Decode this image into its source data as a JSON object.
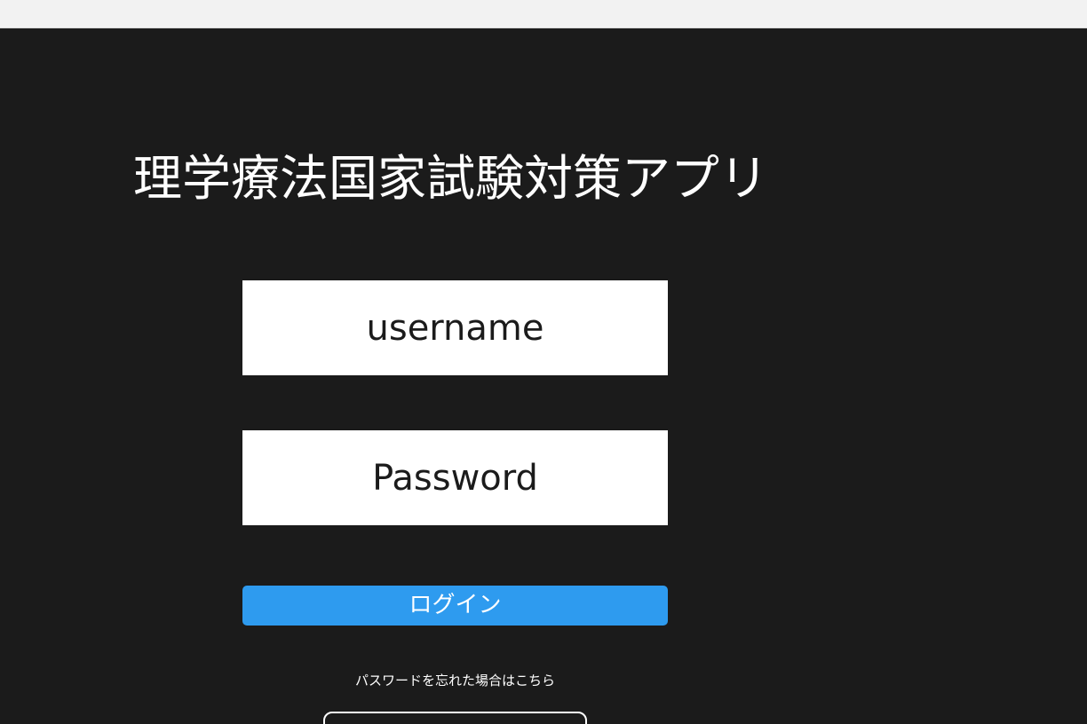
{
  "app": {
    "title": "理学療法国家試験対策アプリ"
  },
  "login_form": {
    "username_placeholder": "username",
    "password_placeholder": "Password",
    "login_label": "ログイン",
    "forgot_password_label": "パスワードを忘れた場合はこちら"
  },
  "colors": {
    "background": "#1b1b1b",
    "top_bar": "#f2f2f2",
    "field_background": "#ffffff",
    "primary_button": "#2e9bef",
    "text_light": "#ffffff",
    "text_dark": "#1b1b1b"
  }
}
